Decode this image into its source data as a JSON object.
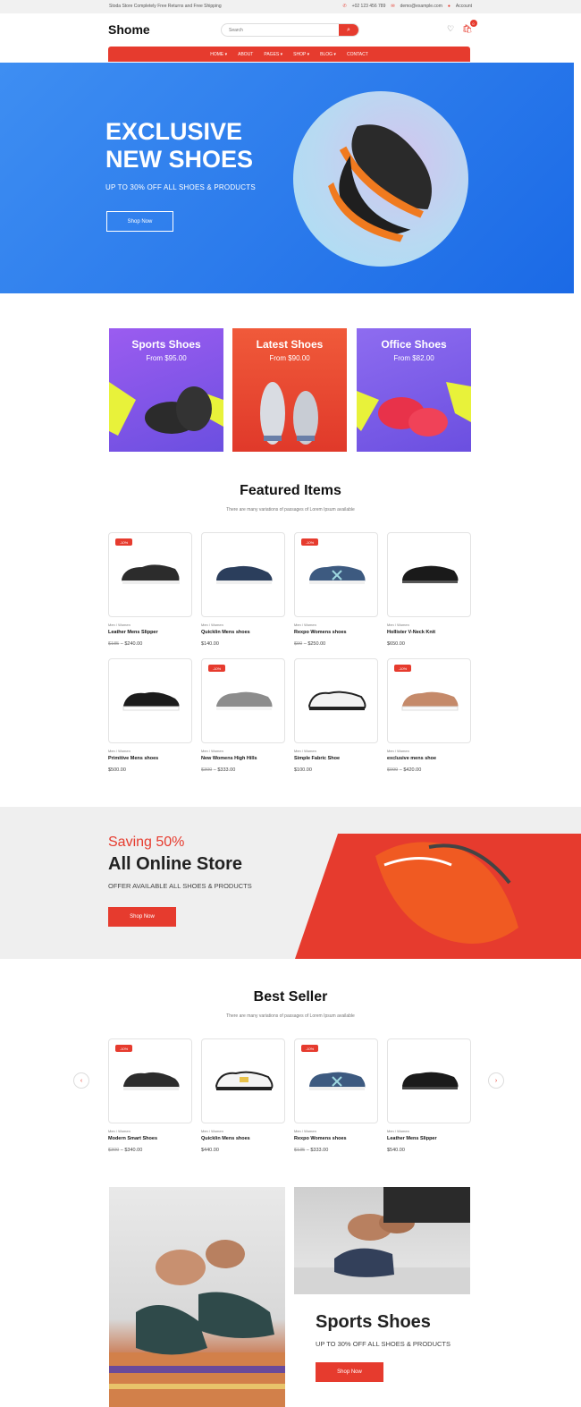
{
  "topbar": {
    "notice": "Stoda Store Completely Free Returns and Free Shipping",
    "phone": "+02 123 456 789",
    "email": "demo@example.com",
    "account": "Account"
  },
  "header": {
    "logo": "Shome",
    "search_placeholder": "Search",
    "cart_count": "0"
  },
  "nav": [
    "HOME",
    "ABOUT",
    "PAGES",
    "SHOP",
    "BLOG",
    "CONTACT"
  ],
  "hero": {
    "title_line1": "EXCLUSIVE",
    "title_line2": "NEW SHOES",
    "subtitle": "UP TO 30% OFF ALL SHOES & PRODUCTS",
    "button": "Shop Now"
  },
  "categories": [
    {
      "name": "Sports Shoes",
      "price": "From $95.00"
    },
    {
      "name": "Latest Shoes",
      "price": "From $90.00"
    },
    {
      "name": "Office Shoes",
      "price": "From $82.00"
    }
  ],
  "featured": {
    "title": "Featured Items",
    "subtitle": "There are many variations of passages of Lorem Ipsum available",
    "products": [
      {
        "category": "Men / Women",
        "name": "Leather Mens Slipper",
        "old": "$185",
        "price": "$240.00",
        "badge": "-10%"
      },
      {
        "category": "Men / Women",
        "name": "Quicklin Mens shoes",
        "old": "",
        "price": "$140.00",
        "badge": ""
      },
      {
        "category": "Men / Women",
        "name": "Rexpo Womens shoes",
        "old": "$90",
        "price": "$250.00",
        "badge": "-10%"
      },
      {
        "category": "Men / Women",
        "name": "Hollister V-Neck Knit",
        "old": "",
        "price": "$650.00",
        "badge": ""
      },
      {
        "category": "Men / Women",
        "name": "Primitive Mens shoes",
        "old": "",
        "price": "$500.00",
        "badge": ""
      },
      {
        "category": "Men / Women",
        "name": "New Womens High Hills",
        "old": "$300",
        "price": "$333.00",
        "badge": "-10%"
      },
      {
        "category": "Men / Women",
        "name": "Simple Fabric Shoe",
        "old": "",
        "price": "$100.00",
        "badge": ""
      },
      {
        "category": "Men / Women",
        "name": "exclusive mens shoe",
        "old": "$999",
        "price": "$420.00",
        "badge": "-10%"
      }
    ]
  },
  "banner": {
    "line1": "Saving 50%",
    "line2": "All Online Store",
    "line3": "OFFER AVAILABLE ALL SHOES & PRODUCTS",
    "button": "Shop Now"
  },
  "bestseller": {
    "title": "Best Seller",
    "subtitle": "There are many variations of passages of Lorem Ipsum available",
    "products": [
      {
        "category": "Men / Women",
        "name": "Modern Smart Shoes",
        "old": "$300",
        "price": "$340.00",
        "badge": "-10%"
      },
      {
        "category": "Men / Women",
        "name": "Quicklin Mens shoes",
        "old": "",
        "price": "$440.00",
        "badge": ""
      },
      {
        "category": "Men / Women",
        "name": "Rexpo Womens shoes",
        "old": "$135",
        "price": "$333.00",
        "badge": "-10%"
      },
      {
        "category": "Men / Women",
        "name": "Leather Mens Slipper",
        "old": "",
        "price": "$540.00",
        "badge": ""
      }
    ]
  },
  "promo": {
    "title": "Sports Shoes",
    "subtitle": "UP TO 30% OFF ALL SHOES & PRODUCTS",
    "button": "Shop Now"
  },
  "colors": {
    "accent": "#e63b2e",
    "hero_blue": "#1b6ae6"
  }
}
